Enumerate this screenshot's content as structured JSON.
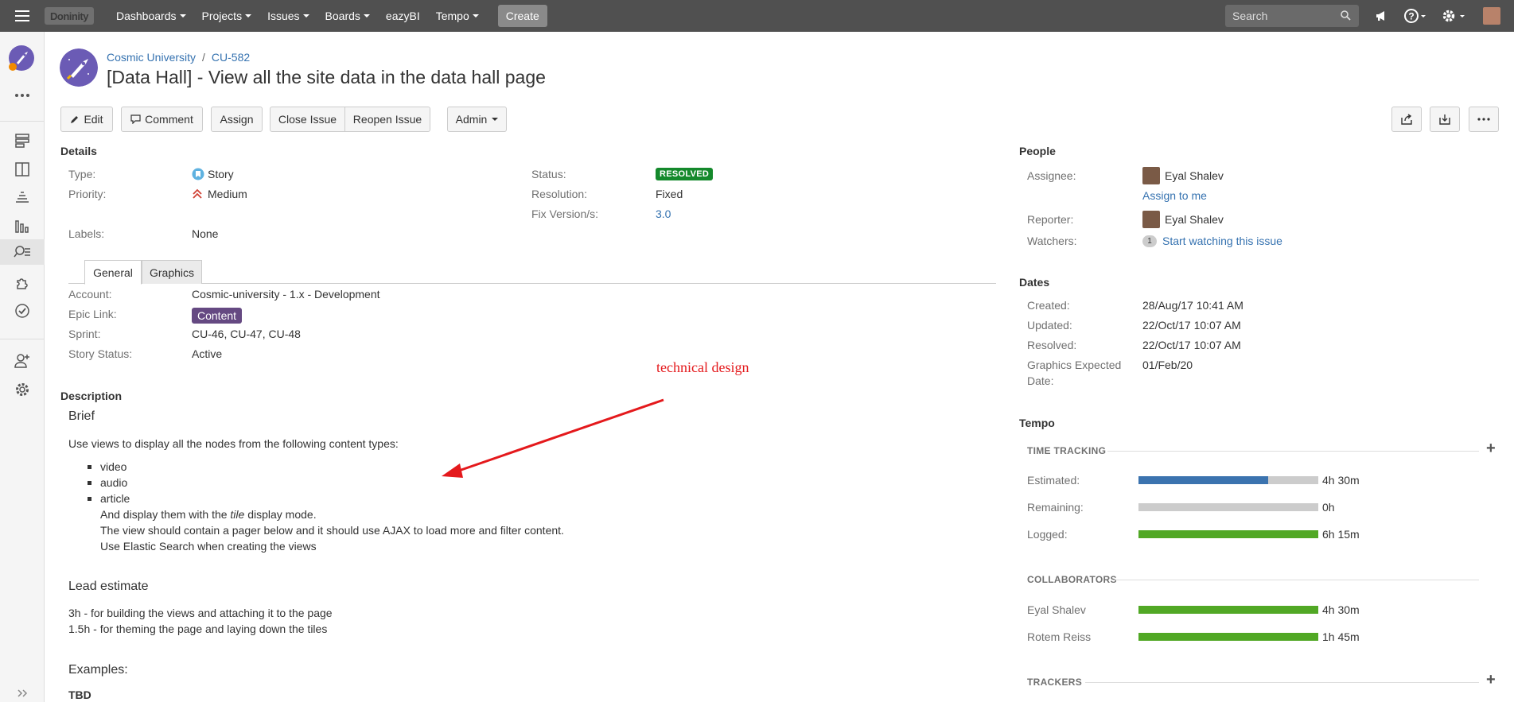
{
  "topbar": {
    "logo": "Doninity",
    "nav": [
      "Dashboards",
      "Projects",
      "Issues",
      "Boards",
      "eazyBI",
      "Tempo"
    ],
    "create": "Create",
    "search_placeholder": "Search",
    "bg_color": "#505050"
  },
  "breadcrumb": {
    "project": "Cosmic University",
    "sep": "/",
    "key": "CU-582"
  },
  "issue": {
    "title": "[Data Hall] - View all the site data in the data hall page"
  },
  "toolbar": {
    "edit": "Edit",
    "comment": "Comment",
    "assign": "Assign",
    "close": "Close Issue",
    "reopen": "Reopen Issue",
    "admin": "Admin"
  },
  "details": {
    "heading": "Details",
    "type_label": "Type:",
    "type_value": "Story",
    "priority_label": "Priority:",
    "priority_value": "Medium",
    "labels_label": "Labels:",
    "labels_value": "None",
    "status_label": "Status:",
    "status_value": "RESOLVED",
    "resolution_label": "Resolution:",
    "resolution_value": "Fixed",
    "fix_label": "Fix Version/s:",
    "fix_value": "3.0"
  },
  "tabs": [
    "General",
    "Graphics"
  ],
  "general": {
    "account_label": "Account:",
    "account_value": "Cosmic-university - 1.x - Development",
    "epic_label": "Epic Link:",
    "epic_value": "Content",
    "sprint_label": "Sprint:",
    "sprint_value": "CU-46, CU-47, CU-48",
    "story_status_label": "Story Status:",
    "story_status_value": "Active"
  },
  "annotation": "technical design",
  "description": {
    "heading": "Description",
    "brief": "Brief",
    "intro": "Use views to display all the nodes from the following content types:",
    "items": [
      "video",
      "audio",
      "article"
    ],
    "line1_pre": "And display them with the ",
    "line1_em": "tile",
    "line1_post": " display mode.",
    "line2": "The view should contain a pager below and it should use AJAX to load more and filter content.",
    "line3": "Use Elastic Search when creating the views",
    "lead_heading": "Lead estimate",
    "lead1": "3h - for building the views and attaching it to the page",
    "lead2": "1.5h - for theming the page and laying down the tiles",
    "examples": "Examples:",
    "tbd": "TBD"
  },
  "people": {
    "heading": "People",
    "assignee_label": "Assignee:",
    "assignee": "Eyal Shalev",
    "assign_to_me": "Assign to me",
    "reporter_label": "Reporter:",
    "reporter": "Eyal Shalev",
    "watchers_label": "Watchers:",
    "watchers_count": "1",
    "watch_link": "Start watching this issue"
  },
  "dates": {
    "heading": "Dates",
    "created_label": "Created:",
    "created": "28/Aug/17 10:41 AM",
    "updated_label": "Updated:",
    "updated": "22/Oct/17 10:07 AM",
    "resolved_label": "Resolved:",
    "resolved": "22/Oct/17 10:07 AM",
    "graphics_label_1": "Graphics Expected",
    "graphics_label_2": "Date:",
    "graphics": "01/Feb/20"
  },
  "tempo": {
    "heading": "Tempo",
    "time_tracking": "TIME TRACKING",
    "estimated_label": "Estimated:",
    "estimated": "4h 30m",
    "estimated_fraction": 0.72,
    "remaining_label": "Remaining:",
    "remaining": "0h",
    "remaining_fraction": 0,
    "logged_label": "Logged:",
    "logged": "6h 15m",
    "logged_fraction": 1.0,
    "collaborators": "COLLABORATORS",
    "collab": [
      {
        "name": "Eyal Shalev",
        "time": "4h 30m",
        "fraction": 1.0
      },
      {
        "name": "Rotem Reiss",
        "time": "1h 45m",
        "fraction": 1.0
      }
    ],
    "trackers": "TRACKERS",
    "colors": {
      "estimated": "#3b73af",
      "logged": "#51a825",
      "track": "#cccccc"
    }
  }
}
